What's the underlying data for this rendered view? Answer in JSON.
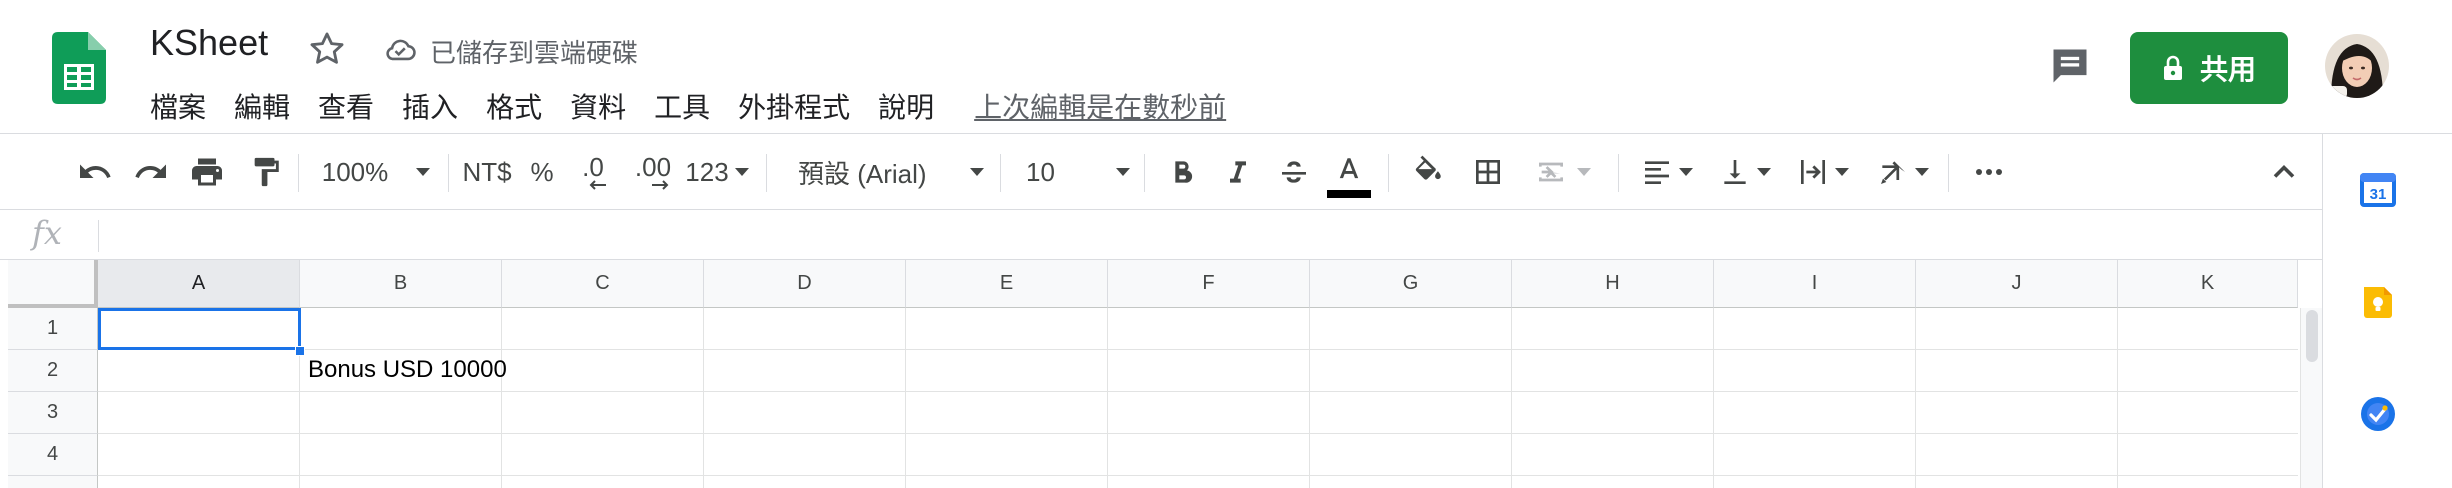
{
  "header": {
    "title": "KSheet",
    "save_status": "已儲存到雲端硬碟",
    "menu": [
      "檔案",
      "編輯",
      "查看",
      "插入",
      "格式",
      "資料",
      "工具",
      "外掛程式",
      "說明"
    ],
    "last_edit": "上次編輯是在數秒前",
    "share_label": "共用",
    "accent_color": "#1e8e3e"
  },
  "toolbar": {
    "zoom": "100%",
    "currency": "NT$",
    "percent": "%",
    "decimal_decrease": ".0",
    "decimal_increase": ".00",
    "number_format": "123",
    "font_family": "預設 (Arial)",
    "font_size": "10",
    "icons": [
      "undo-icon",
      "redo-icon",
      "print-icon",
      "paint-format-icon",
      "bold-icon",
      "italic-icon",
      "strikethrough-icon",
      "text-color-icon",
      "fill-color-icon",
      "borders-icon",
      "merge-cells-icon",
      "align-left-icon",
      "vertical-align-icon",
      "text-wrap-icon",
      "text-rotate-icon",
      "more-icon",
      "collapse-icon"
    ]
  },
  "formula_bar": {
    "fx_label": "fx",
    "value": ""
  },
  "grid": {
    "columns": [
      "A",
      "B",
      "C",
      "D",
      "E",
      "F",
      "G",
      "H",
      "I",
      "J",
      "K"
    ],
    "rows": [
      "1",
      "2",
      "3",
      "4"
    ],
    "selected_cell": "A1",
    "cells": {
      "B2": "Bonus USD 10000"
    }
  },
  "side_panel": {
    "calendar_day": "31",
    "icons": [
      "calendar-icon",
      "keep-icon",
      "tasks-icon"
    ]
  }
}
